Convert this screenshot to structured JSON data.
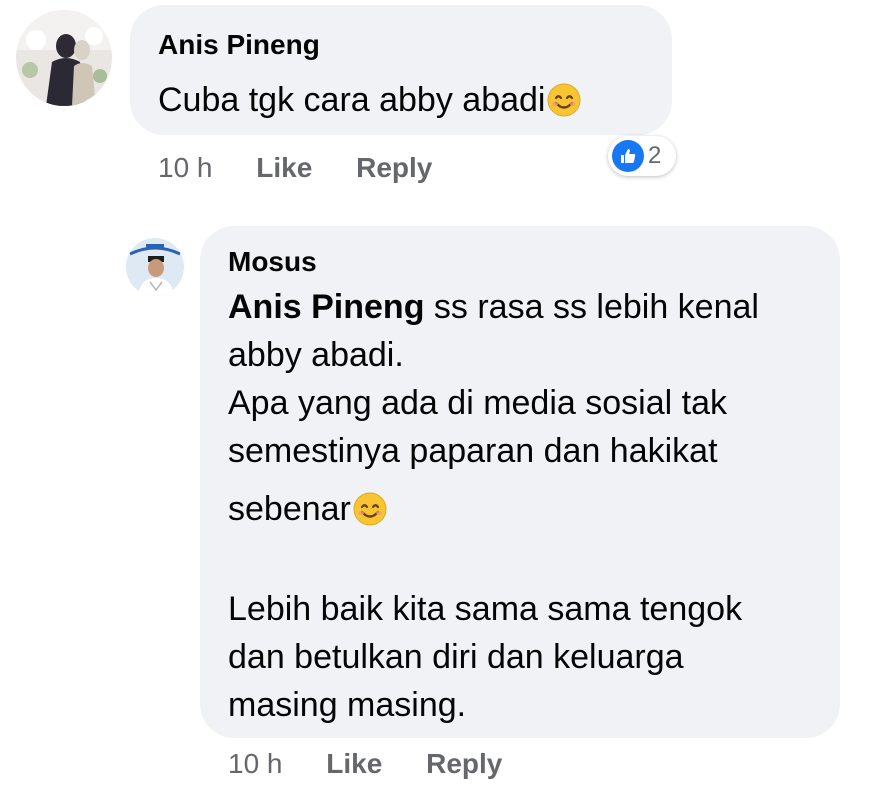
{
  "comment1": {
    "author": "Anis Pineng",
    "text": "Cuba tgk cara abby abadi",
    "emoji": "smiling-face-icon",
    "time": "10 h",
    "like_label": "Like",
    "reply_label": "Reply",
    "reaction_icon": "like-icon",
    "reaction_count": "2"
  },
  "reply1": {
    "author": "Mosus",
    "mention": "Anis Pineng",
    "lines": [
      " ss rasa ss lebih kenal",
      "abby abadi.",
      "Apa yang ada di media sosial tak",
      "semestinya paparan dan hakikat",
      "sebenar",
      "Lebih baik kita sama sama tengok",
      "dan betulkan diri dan keluarga",
      "masing masing."
    ],
    "emoji": "smiling-face-icon",
    "time": "10 h",
    "like_label": "Like",
    "reply_label": "Reply"
  },
  "colors": {
    "bubble": "#f0f2f5",
    "meta_text": "#65676b",
    "like_blue": "#1877f2"
  }
}
